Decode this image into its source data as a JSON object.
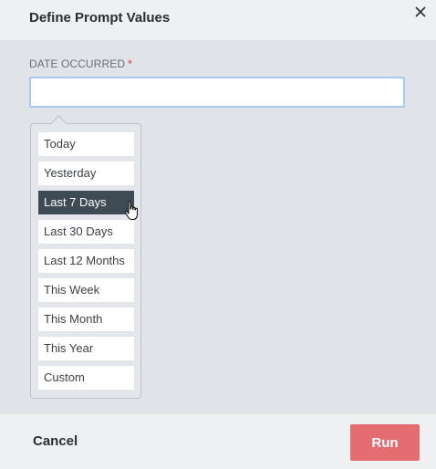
{
  "dialog": {
    "title": "Define Prompt Values",
    "close_icon": "close-icon"
  },
  "field": {
    "label": "DATE OCCURRED",
    "required_marker": "*",
    "value": "",
    "placeholder": ""
  },
  "dropdown": {
    "options": [
      {
        "label": "Today",
        "selected": false
      },
      {
        "label": "Yesterday",
        "selected": false
      },
      {
        "label": "Last 7 Days",
        "selected": true
      },
      {
        "label": "Last 30 Days",
        "selected": false
      },
      {
        "label": "Last 12 Months",
        "selected": false
      },
      {
        "label": "This Week",
        "selected": false
      },
      {
        "label": "This Month",
        "selected": false
      },
      {
        "label": "This Year",
        "selected": false
      },
      {
        "label": "Custom",
        "selected": false
      }
    ]
  },
  "footer": {
    "cancel_label": "Cancel",
    "run_label": "Run"
  },
  "colors": {
    "run_button": "#e36d70",
    "selected_option": "#3e4a54",
    "required": "#d9363e",
    "input_focus_border": "#a9c9ee"
  }
}
